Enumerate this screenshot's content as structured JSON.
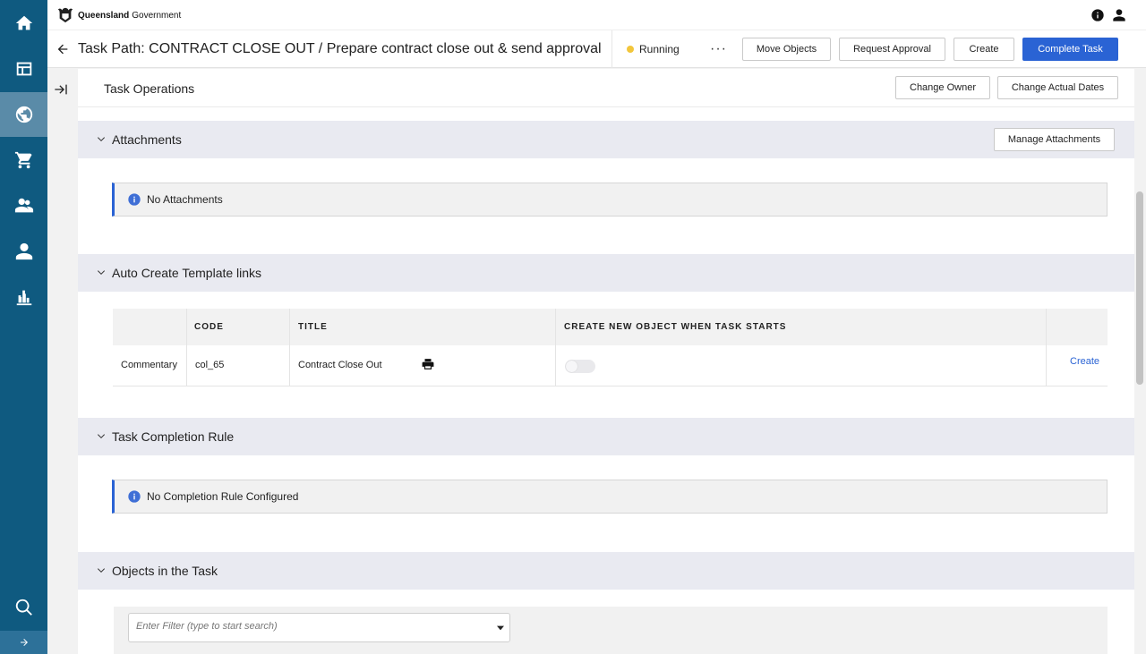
{
  "gov": {
    "name_bold": "Queensland",
    "name_rest": "Government"
  },
  "header": {
    "title": "Task Path: CONTRACT CLOSE OUT / Prepare contract close out & send approval",
    "status": "Running",
    "status_color": "#f2c63b",
    "more": "···",
    "buttons": {
      "move_objects": "Move Objects",
      "request_approval": "Request Approval",
      "create": "Create",
      "complete_task": "Complete Task"
    }
  },
  "sidebar": {
    "items": [
      "home-icon",
      "dashboard-icon",
      "globe-icon",
      "cart-icon",
      "group-icon",
      "user-icon",
      "chart-icon",
      "search-icon"
    ],
    "active": "globe-icon"
  },
  "operations": {
    "title": "Task Operations",
    "change_owner": "Change Owner",
    "change_actual_dates": "Change Actual Dates"
  },
  "attachments": {
    "title": "Attachments",
    "manage": "Manage Attachments",
    "empty": "No Attachments"
  },
  "template_links": {
    "title": "Auto Create Template links",
    "columns": [
      "",
      "CODE",
      "TITLE",
      "CREATE NEW OBJECT WHEN TASK STARTS",
      ""
    ],
    "rows": [
      {
        "type": "Commentary",
        "code": "col_65",
        "title": "Contract Close Out",
        "create_on_start": false,
        "action": "Create"
      }
    ]
  },
  "completion_rule": {
    "title": "Task Completion Rule",
    "empty": "No Completion Rule Configured"
  },
  "objects": {
    "title": "Objects in the Task",
    "filter_placeholder": "Enter Filter (type to start search)"
  },
  "colors": {
    "primary": "#2a63d4",
    "sidebar": "#0f5a80",
    "section_bg": "#e9eaf1"
  }
}
